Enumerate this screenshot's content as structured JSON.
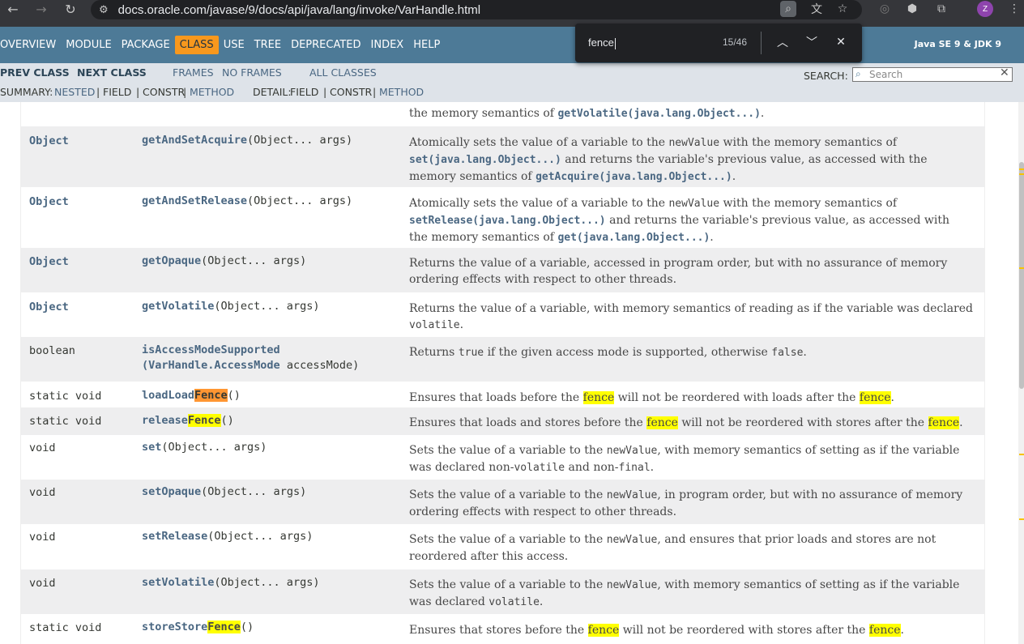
{
  "browser": {
    "url": "docs.oracle.com/javase/9/docs/api/java/lang/invoke/VarHandle.html",
    "profile_initial": "Z"
  },
  "find_bar": {
    "query": "fence",
    "count": "15/46"
  },
  "topnav": {
    "items": [
      "OVERVIEW",
      "MODULE",
      "PACKAGE",
      "CLASS",
      "USE",
      "TREE",
      "DEPRECATED",
      "INDEX",
      "HELP"
    ],
    "active": "CLASS",
    "about": "Java SE 9 & JDK 9"
  },
  "subnav": {
    "prev_class": "PREV CLASS",
    "next_class": "NEXT CLASS",
    "frames": "FRAMES",
    "no_frames": "NO FRAMES",
    "all_classes": "ALL CLASSES",
    "search_label": "SEARCH:",
    "search_placeholder": "Search",
    "summary_label": "SUMMARY:",
    "summary_nested": "NESTED",
    "summary_field": "FIELD",
    "summary_constr": "CONSTR",
    "summary_method": "METHOD",
    "detail_label": "DETAIL:",
    "detail_field": "FIELD",
    "detail_constr": "CONSTR",
    "detail_method": "METHOD",
    "sep": "|"
  },
  "methods": {
    "partial_prefix": "the memory semantics of ",
    "partial_code": "getVolatile(java.lang.Object...)",
    "rows": [
      {
        "type": "Object",
        "name": "getAndSetAcquire",
        "params": "(Object... args)",
        "desc1": "Atomically sets the value of a variable to the ",
        "desc1code": "newValue",
        "desc1b": " with the memory semantics of",
        "desc2code": "set(java.lang.Object...)",
        "desc2": " and returns the variable's previous value, as accessed with the",
        "desc3": "memory semantics of ",
        "desc3code": "getAcquire(java.lang.Object...)",
        "desc3end": "."
      },
      {
        "type": "Object",
        "name": "getAndSetRelease",
        "params": "(Object... args)",
        "desc1": "Atomically sets the value of a variable to the ",
        "desc1code": "newValue",
        "desc1b": " with the memory semantics of",
        "desc2code": "setRelease(java.lang.Object...)",
        "desc2": " and returns the variable's previous value, as accessed with",
        "desc3": "the memory semantics of ",
        "desc3code": "get(java.lang.Object...)",
        "desc3end": "."
      },
      {
        "type": "Object",
        "name": "getOpaque",
        "params": "(Object... args)",
        "desc": "Returns the value of a variable, accessed in program order, but with no assurance of memory ordering effects with respect to other threads."
      },
      {
        "type": "Object",
        "name": "getVolatile",
        "params": "(Object... args)",
        "desc1": "Returns the value of a variable, with memory semantics of reading as if the variable was declared",
        "desc2code": "volatile",
        "desc2": "."
      },
      {
        "type": "boolean",
        "name": "isAccessModeSupported",
        "params_line1": "(VarHandle.AccessMode",
        "params_line1b": " accessMode)",
        "desc_a": "Returns ",
        "desc_true": "true",
        "desc_b": " if the given access mode is supported, otherwise ",
        "desc_false": "false",
        "desc_c": "."
      },
      {
        "type": "static void",
        "name_pre": "loadLoad",
        "name_hl": "Fence",
        "params": "()",
        "desc_a": "Ensures that loads before the ",
        "hl1": "fence",
        "desc_b": " will not be reordered with loads after the ",
        "hl2": "fence",
        "desc_c": "."
      },
      {
        "type": "static void",
        "name_pre": "release",
        "name_hl": "Fence",
        "params": "()",
        "desc_a": "Ensures that loads and stores before the ",
        "hl1": "fence",
        "desc_b": " will not be reordered with stores after the ",
        "hl2": "fence",
        "desc_c": "."
      },
      {
        "type": "void",
        "name": "set",
        "params": "(Object... args)",
        "desc1": "Sets the value of a variable to the ",
        "desc1code": "newValue",
        "desc1b": ", with memory semantics of setting as if the variable",
        "desc2": "was declared non-",
        "desc2code": "volatile",
        "desc2b": " and non-",
        "desc2code2": "final",
        "desc2end": "."
      },
      {
        "type": "void",
        "name": "setOpaque",
        "params": "(Object... args)",
        "desc1": "Sets the value of a variable to the ",
        "desc1code": "newValue",
        "desc1b": ", in program order, but with no assurance of memory",
        "desc2": "ordering effects with respect to other threads."
      },
      {
        "type": "void",
        "name": "setRelease",
        "params": "(Object... args)",
        "desc1": "Sets the value of a variable to the ",
        "desc1code": "newValue",
        "desc1b": ", and ensures that prior loads and stores are not",
        "desc2": "reordered after this access."
      },
      {
        "type": "void",
        "name": "setVolatile",
        "params": "(Object... args)",
        "desc1": "Sets the value of a variable to the ",
        "desc1code": "newValue",
        "desc1b": ", with memory semantics of setting as if the variable",
        "desc2": "was declared ",
        "desc2code": "volatile",
        "desc2end": "."
      },
      {
        "type": "static void",
        "name_pre": "storeStore",
        "name_hl": "Fence",
        "params": "()",
        "desc_a": "Ensures that stores before the ",
        "hl1": "fence",
        "desc_b": " will not be reordered with stores after the ",
        "hl2": "fence",
        "desc_c": "."
      }
    ]
  },
  "colors": {
    "nav_bg": "#4d7a97",
    "subnav_bg": "#dee3e9",
    "active_tab": "#f8981d",
    "link": "#4a6782",
    "row_alt": "#eeeeef",
    "highlight": "#ffff00",
    "highlight_current": "#ff9632"
  }
}
